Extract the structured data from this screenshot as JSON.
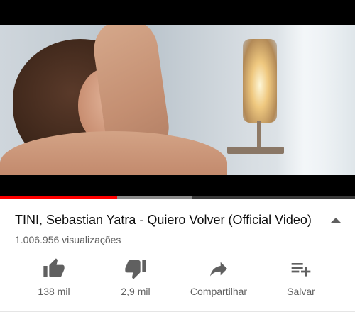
{
  "video": {
    "title": "TINI, Sebastian Yatra - Quiero Volver (Official Video)",
    "views": "1.006.956 visualizações",
    "progress_played_fraction": 0.33,
    "progress_buffered_fraction": 0.54
  },
  "actions": [
    {
      "label": "138 mil",
      "icon": "thumbs-up-icon"
    },
    {
      "label": "2,9 mil",
      "icon": "thumbs-down-icon"
    },
    {
      "label": "Compartilhar",
      "icon": "share-icon"
    },
    {
      "label": "Salvar",
      "icon": "playlist-add-icon"
    }
  ],
  "colors": {
    "accent": "#ff0000",
    "text_primary": "#0f0f0f",
    "text_secondary": "#606060"
  }
}
